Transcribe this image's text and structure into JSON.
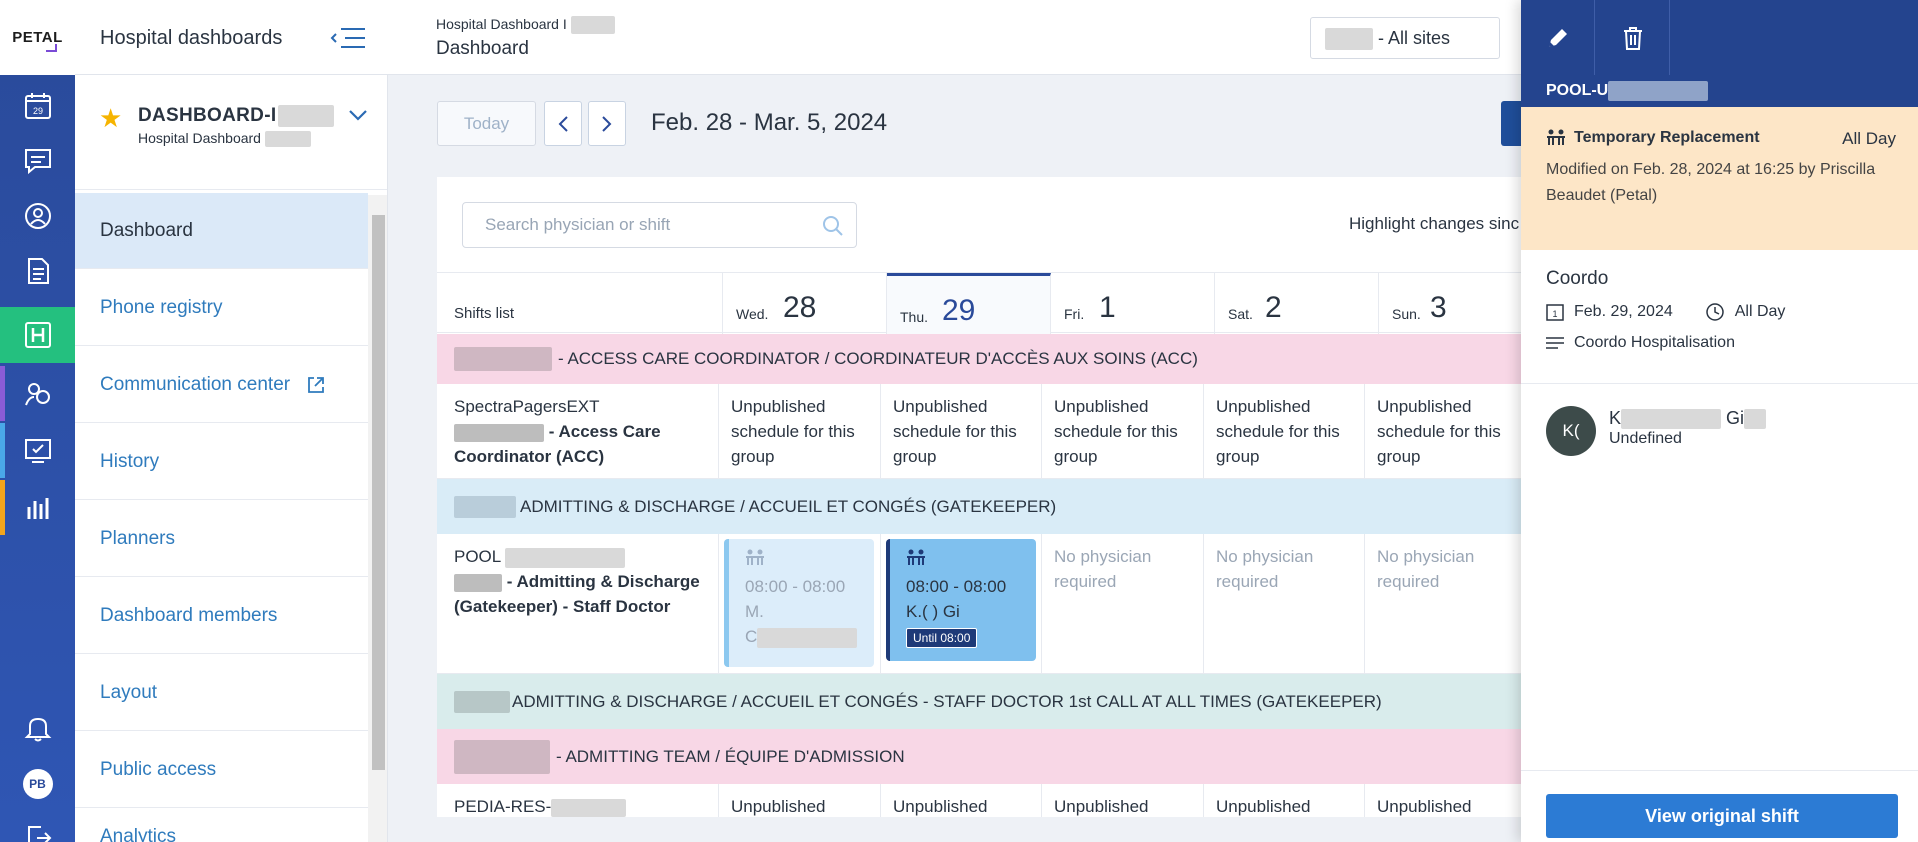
{
  "brand": {
    "logo_text": "PETAL"
  },
  "rail": {
    "calendar_day": "29",
    "avatar_initials": "PB"
  },
  "topbar": {
    "app_title": "Hospital dashboards",
    "breadcrumb_small": "Hospital Dashboard I",
    "breadcrumb_title": "Dashboard",
    "site_select": "- All sites"
  },
  "dashboard": {
    "name": "DASHBOARD-I",
    "subtitle": "Hospital Dashboard"
  },
  "nav": {
    "items": [
      {
        "label": "Dashboard"
      },
      {
        "label": "Phone registry"
      },
      {
        "label": "Communication center"
      },
      {
        "label": "History"
      },
      {
        "label": "Planners"
      },
      {
        "label": "Dashboard members"
      },
      {
        "label": "Layout"
      },
      {
        "label": "Public access"
      },
      {
        "label": "Analytics"
      }
    ]
  },
  "toolbar": {
    "today_label": "Today",
    "prev_icon": "chevron-left",
    "next_icon": "chevron-right",
    "date_range": "Feb. 28 - Mar. 5, 2024"
  },
  "search": {
    "placeholder": "Search physician or shift"
  },
  "highlight_label": "Highlight changes sinc",
  "grid": {
    "shifts_list_label": "Shifts list",
    "days": [
      {
        "dow": "Wed.",
        "num": "28"
      },
      {
        "dow": "Thu.",
        "num": "29"
      },
      {
        "dow": "Fri.",
        "num": "1"
      },
      {
        "dow": "Sat.",
        "num": "2"
      },
      {
        "dow": "Sun.",
        "num": "3"
      }
    ],
    "groups": [
      {
        "title": "- ACCESS CARE COORDINATOR / COORDINATEUR D'ACCÈS AUX SOINS (ACC)",
        "row": {
          "line1": "SpectraPagersEXT",
          "line2": "- Access Care",
          "line3": "Coordinator (ACC)",
          "cells": [
            "Unpublished schedule for this group",
            "Unpublished schedule for this group",
            "Unpublished schedule for this group",
            "Unpublished schedule for this group",
            "Unpublished schedule for this group"
          ]
        }
      },
      {
        "title": "ADMITTING & DISCHARGE / ACCUEIL ET CONGÉS (GATEKEEPER)",
        "row": {
          "line1": "POOL",
          "line2": "- Admitting & Discharge",
          "line3": "(Gatekeeper) - Staff Doctor",
          "wed": {
            "time": "08:00 - 08:00",
            "name1": "M.",
            "name2": "C"
          },
          "thu": {
            "time": "08:00 - 08:00",
            "name": "K.(    ) Gi",
            "badge": "Until 08:00"
          },
          "cells": [
            "No physician required",
            "No physician required",
            "No physician required"
          ]
        }
      },
      {
        "title": "ADMITTING & DISCHARGE / ACCUEIL ET CONGÉS - STAFF DOCTOR 1st CALL AT ALL TIMES (GATEKEEPER)"
      },
      {
        "title": "- ADMITTING TEAM / ÉQUIPE D'ADMISSION",
        "row": {
          "line1": "PEDIA-RES-",
          "cells": [
            "Unpublished",
            "Unpublished",
            "Unpublished",
            "Unpublished",
            "Unpublished"
          ]
        }
      }
    ]
  },
  "drawer": {
    "shift_id": "POOL-U",
    "notice_type": "Temporary Replacement",
    "notice_allday": "All Day",
    "notice_modified": "Modified on Feb. 28, 2024 at 16:25 by Priscilla Beaudet (Petal)",
    "info_title": "Coordo",
    "info_date": "Feb. 29, 2024",
    "info_time": "All Day",
    "info_desc": "Coordo Hospitalisation",
    "person_initials": "K(",
    "person_name": "K",
    "person_name_tail": "Gi",
    "person_role": "Undefined",
    "view_button": "View original shift"
  },
  "colors": {
    "rail_bg": "#2f56b4",
    "active_rail": "#24c07f",
    "group_pink": "#f8d7e6",
    "group_blue": "#d9ecf7",
    "group_teal": "#d9ecec",
    "shift_light": "#dcedfa",
    "shift_selected": "#7fc0ee",
    "drawer_header": "#24448e",
    "notice_bg": "#fde6c7",
    "primary_button": "#2c7bd4"
  }
}
